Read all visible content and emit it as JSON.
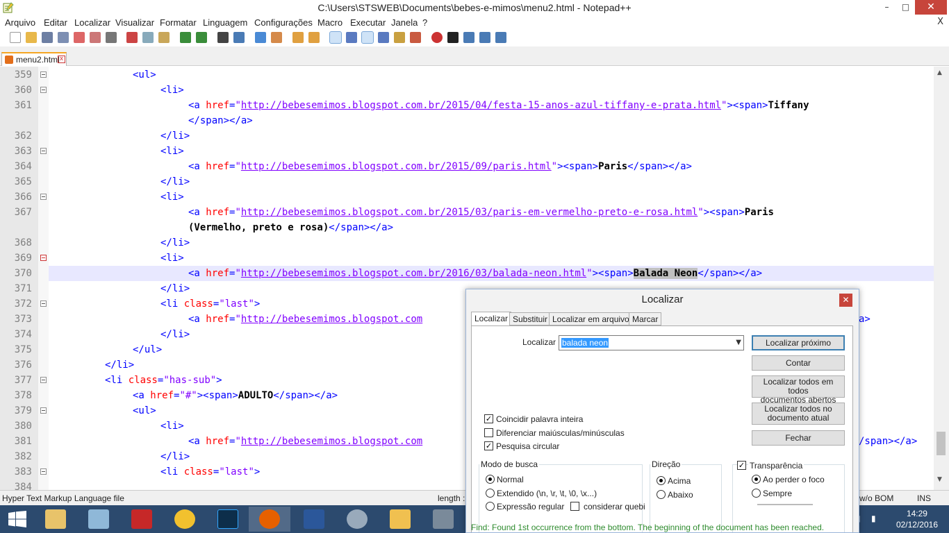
{
  "window": {
    "title": "C:\\Users\\STSWEB\\Documents\\bebes-e-mimos\\menu2.html - Notepad++",
    "minimize": "–",
    "maximize": "□",
    "close": "✕"
  },
  "menu": [
    "Arquivo",
    "Editar",
    "Localizar",
    "Visualizar",
    "Formatar",
    "Linguagem",
    "Configurações",
    "Macro",
    "Executar",
    "Janela",
    "?"
  ],
  "menu_close": "X",
  "tab": {
    "label": "menu2.html",
    "close": "x"
  },
  "editor": {
    "line_numbers": [
      "359",
      "360",
      "361",
      "",
      "362",
      "363",
      "364",
      "365",
      "366",
      "367",
      "",
      "368",
      "369",
      "370",
      "371",
      "372",
      "373",
      "374",
      "375",
      "376",
      "377",
      "378",
      "379",
      "380",
      "381",
      "382",
      "383",
      "384"
    ]
  },
  "status": {
    "file_type": "Hyper Text Markup Language file",
    "length": "length :",
    "encoding": "w/o BOM",
    "mode": "INS"
  },
  "dialog": {
    "title": "Localizar",
    "close": "✕",
    "tabs": [
      "Localizar",
      "Substituir",
      "Localizar em arquivos",
      "Marcar"
    ],
    "find_label": "Localizar :",
    "find_value": "balada neon",
    "buttons": {
      "find_next": "Localizar próximo",
      "count": "Contar",
      "find_all_open_1": "Localizar todos em todos",
      "find_all_open_2": "documentos abertos",
      "find_all_current_1": "Localizar todos no",
      "find_all_current_2": "documento atual",
      "close": "Fechar"
    },
    "options": {
      "whole_word": "Coincidir palavra inteira",
      "match_case": "Diferenciar maiúsculas/minúsculas",
      "wrap": "Pesquisa circular"
    },
    "search_mode": {
      "title": "Modo de busca",
      "normal": "Normal",
      "extended": "Extendido  (\\n, \\r, \\t, \\0, \\x...)",
      "regex": "Expressão regular",
      "dot_newline": "considerar quebi"
    },
    "direction": {
      "title": "Direção",
      "up": "Acima",
      "down": "Abaixo"
    },
    "transparency": {
      "title": "Transparência",
      "on_lose_focus": "Ao perder o foco",
      "always": "Sempre"
    },
    "status_message": "Find: Found 1st occurrence from the bottom. The beginning of the document has been reached."
  },
  "taskbar": {
    "time": "14:29",
    "date": "02/12/2016"
  },
  "colors": {
    "tag": "#0000ff",
    "attribute": "#ff0000",
    "value": "#8000ff",
    "current_line": "#e8e8ff",
    "taskbar": "#2c4a6e"
  }
}
